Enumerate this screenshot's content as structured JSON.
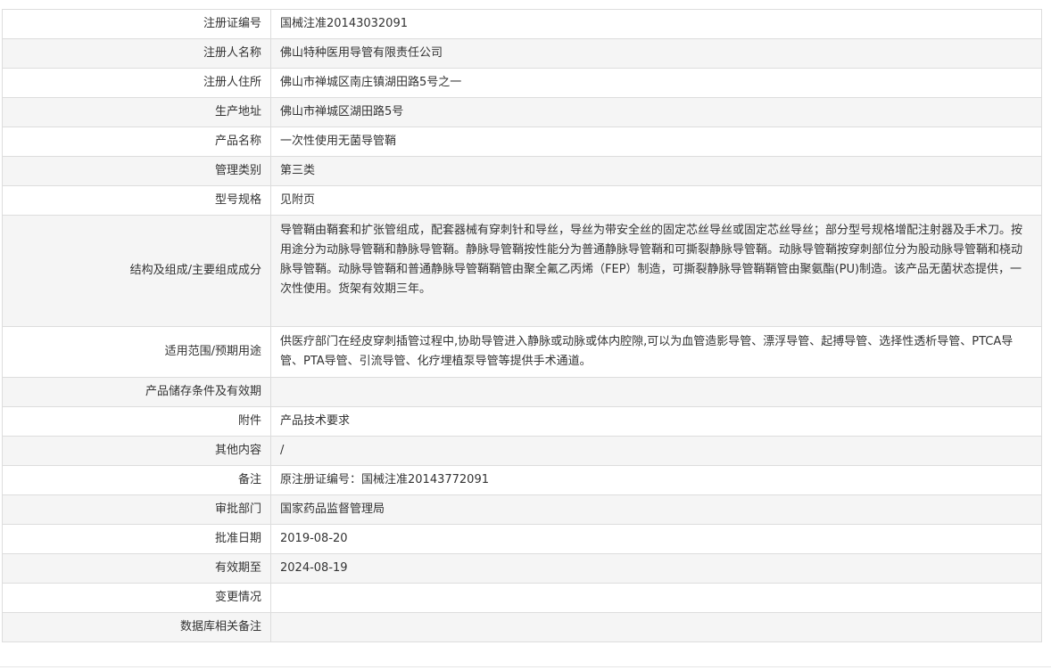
{
  "rows": [
    {
      "label": "注册证编号",
      "value": "国械注准20143032091"
    },
    {
      "label": "注册人名称",
      "value": "佛山特种医用导管有限责任公司"
    },
    {
      "label": "注册人住所",
      "value": "佛山市禅城区南庄镇湖田路5号之一"
    },
    {
      "label": "生产地址",
      "value": "佛山市禅城区湖田路5号"
    },
    {
      "label": "产品名称",
      "value": "一次性使用无菌导管鞘"
    },
    {
      "label": "管理类别",
      "value": "第三类"
    },
    {
      "label": "型号规格",
      "value": "见附页"
    },
    {
      "label": "结构及组成/主要组成成分",
      "value": "导管鞘由鞘套和扩张管组成，配套器械有穿刺针和导丝，导丝为带安全丝的固定芯丝导丝或固定芯丝导丝；部分型号规格增配注射器及手术刀。按用途分为动脉导管鞘和静脉导管鞘。静脉导管鞘按性能分为普通静脉导管鞘和可撕裂静脉导管鞘。动脉导管鞘按穿刺部位分为股动脉导管鞘和桡动脉导管鞘。动脉导管鞘和普通静脉导管鞘鞘管由聚全氟乙丙烯（FEP）制造，可撕裂静脉导管鞘鞘管由聚氨酯(PU)制造。该产品无菌状态提供，一次性使用。货架有效期三年。"
    },
    {
      "label": "适用范围/预期用途",
      "value": "供医疗部门在经皮穿刺插管过程中,协助导管进入静脉或动脉或体内腔隙,可以为血管造影导管、漂浮导管、起搏导管、选择性透析导管、PTCA导管、PTA导管、引流导管、化疗埋植泵导管等提供手术通道。"
    },
    {
      "label": "产品储存条件及有效期",
      "value": ""
    },
    {
      "label": "附件",
      "value": "产品技术要求"
    },
    {
      "label": "其他内容",
      "value": "/"
    },
    {
      "label": "备注",
      "value": "原注册证编号：国械注准20143772091"
    },
    {
      "label": "审批部门",
      "value": "国家药品监督管理局"
    },
    {
      "label": "批准日期",
      "value": "2019-08-20"
    },
    {
      "label": "有效期至",
      "value": "2024-08-19"
    },
    {
      "label": "变更情况",
      "value": ""
    },
    {
      "label": "数据库相关备注",
      "value": ""
    }
  ]
}
